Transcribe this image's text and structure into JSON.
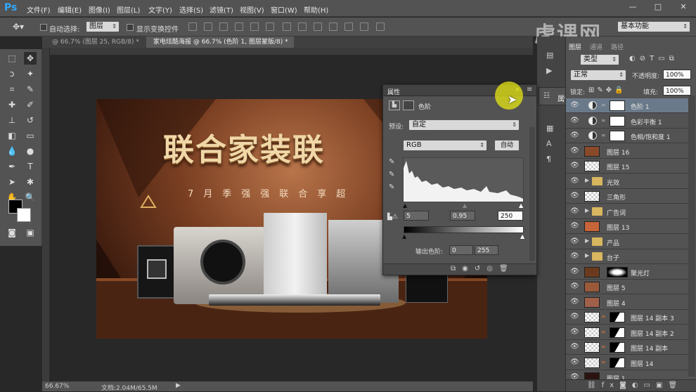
{
  "app": {
    "logo": "Ps"
  },
  "menu": [
    "文件(F)",
    "编辑(E)",
    "图像(I)",
    "图层(L)",
    "文字(Y)",
    "选择(S)",
    "滤镜(T)",
    "视图(V)",
    "窗口(W)",
    "帮助(H)"
  ],
  "window_controls": [
    "—",
    "□",
    "✕"
  ],
  "options": {
    "auto_select_label": "自动选择:",
    "auto_select_value": "图层",
    "show_transform_label": "显示变换控件",
    "workspace": "基本功能"
  },
  "watermark": "虎课网",
  "tabs": [
    {
      "label": "@ 66.7% (图层 25, RGB/8) *",
      "close": "×"
    },
    {
      "label": "家电炫酷海报 @ 66.7% (色阶 1, 图层蒙版/8) *",
      "close": "×"
    }
  ],
  "poster": {
    "title": "联合家装联",
    "subtitle": "7月季强强联合享超"
  },
  "status": {
    "zoom": "66.67%",
    "doc": "文档:2.04M/65.5M"
  },
  "properties": {
    "title": "属性",
    "type_label": "色阶",
    "preset_label": "预设:",
    "preset_value": "自定",
    "channel": "RGB",
    "auto_button": "自动",
    "input_black": "5",
    "input_gray": "0.95",
    "input_white": "250",
    "output_label": "输出色阶:",
    "output_black": "0",
    "output_white": "255"
  },
  "collapsed_panel": {
    "label": "属性"
  },
  "layers_panel": {
    "tabs": [
      "图层",
      "通道",
      "路径"
    ],
    "kind_label": "类型",
    "blend_mode": "正常",
    "opacity_label": "不透明度:",
    "opacity_value": "100%",
    "lock_label": "锁定:",
    "fill_label": "填充:",
    "fill_value": "100%",
    "layers": [
      {
        "name": "色阶 1",
        "kind": "adjust",
        "selected": true
      },
      {
        "name": "色彩平衡 1",
        "kind": "adjust"
      },
      {
        "name": "色相/饱和度 1",
        "kind": "adjust"
      },
      {
        "name": "图层 16",
        "kind": "photo",
        "thumb": "#8a4a2a"
      },
      {
        "name": "图层 15",
        "kind": "checker"
      },
      {
        "name": "光效",
        "kind": "group"
      },
      {
        "name": "三角形",
        "kind": "checker"
      },
      {
        "name": "广告词",
        "kind": "group"
      },
      {
        "name": "图层 13",
        "kind": "photo",
        "thumb": "#c8643a"
      },
      {
        "name": "产品",
        "kind": "group"
      },
      {
        "name": "台子",
        "kind": "group"
      },
      {
        "name": "聚光灯",
        "kind": "photomask",
        "thumb": "#6b3a1e"
      },
      {
        "name": "图层 5",
        "kind": "photo",
        "thumb": "#9a5a3a"
      },
      {
        "name": "图层 4",
        "kind": "photo",
        "thumb": "#a0604a"
      },
      {
        "name": "图层 14 副本 3",
        "kind": "stripe"
      },
      {
        "name": "图层 14 副本 2",
        "kind": "stripe"
      },
      {
        "name": "图层 14 副本",
        "kind": "stripe"
      },
      {
        "name": "图层 14",
        "kind": "stripe"
      },
      {
        "name": "图层 1",
        "kind": "photo",
        "thumb": "#2b1410"
      }
    ]
  }
}
